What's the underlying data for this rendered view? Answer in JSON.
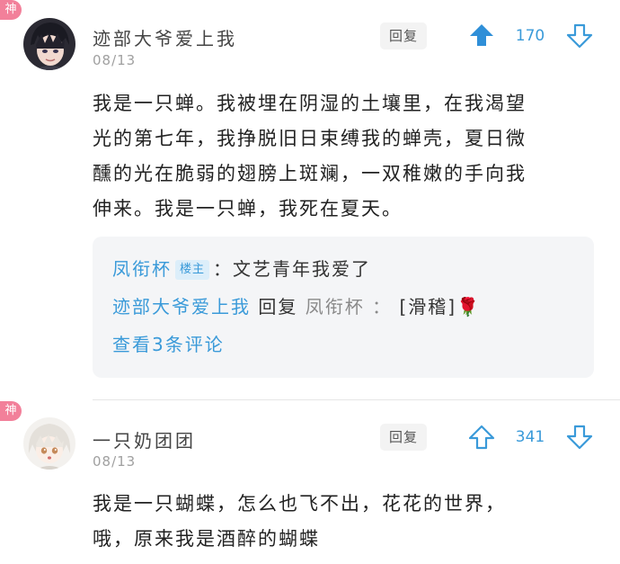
{
  "comments": [
    {
      "badge": "神",
      "username": "迹部大爷爱上我",
      "date": "08/13",
      "reply_label": "回复",
      "votes": "170",
      "upvoted": true,
      "body_lines": [
        "我是一只蝉。我被埋在阴湿的土壤里，在我渴望",
        "光的第七年，我挣脱旧日束缚我的蝉壳，夏日微",
        "醺的光在脆弱的翅膀上斑斓，一双稚嫩的手向我",
        "伸来。我是一只蝉，我死在夏天。"
      ],
      "sub_replies": {
        "first": {
          "user": "凤衔杯",
          "tag": "楼主",
          "text": "：文艺青年我爱了"
        },
        "second": {
          "user": "迹部大爷爱上我",
          "reply_word": "回复",
          "target": "凤衔杯",
          "colon": "：",
          "text": "[滑稽]",
          "emoji": "🌹"
        },
        "view_more": "查看3条评论"
      }
    },
    {
      "badge": "神",
      "username": "一只奶团团",
      "date": "08/13",
      "reply_label": "回复",
      "votes": "341",
      "upvoted": false,
      "body_lines": [
        "我是一只蝴蝶，怎么也飞不出，花花的世界，",
        "哦，原来我是酒醉的蝴蝶"
      ]
    }
  ],
  "colors": {
    "accent": "#3a9ad9",
    "badge": "#f2809a",
    "sub_bg": "#f4f5f7"
  },
  "icons": {
    "upvote": "arrow-up-icon",
    "downvote": "arrow-down-icon"
  }
}
